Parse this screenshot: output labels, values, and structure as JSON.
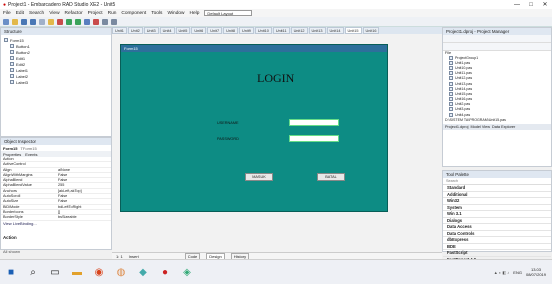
{
  "window": {
    "title": "Project1 - Embarcadero RAD Studio XE2 - Unit5",
    "min": "—",
    "max": "□",
    "close": "✕"
  },
  "menu": [
    "File",
    "Edit",
    "Search",
    "View",
    "Refactor",
    "Project",
    "Run",
    "Component",
    "Tools",
    "Window",
    "Help"
  ],
  "layout_combo": "Default Layout",
  "tabs": [
    "Unit1",
    "Unit2",
    "Unit3",
    "Unit4",
    "Unit5",
    "Unit6",
    "Unit7",
    "Unit8",
    "Unit9",
    "Unit10",
    "Unit11",
    "Unit12",
    "Unit13",
    "Unit14",
    "Unit15",
    "Unit16"
  ],
  "structure": {
    "title": "Structure",
    "items": [
      "Form15",
      "Button1",
      "Button2",
      "Edit1",
      "Edit2",
      "Label1",
      "Label2",
      "Label3"
    ]
  },
  "object_inspector": {
    "title": "Object Inspector",
    "selected": "Form15",
    "selected_type": "TForm15",
    "tabs": [
      "Properties",
      "Events"
    ],
    "rows": [
      [
        "Action",
        ""
      ],
      [
        "ActiveControl",
        ""
      ],
      [
        "Align",
        "alNone"
      ],
      [
        "AlignWithMargins",
        "False"
      ],
      [
        "AlphaBlend",
        "False"
      ],
      [
        "AlphaBlendValue",
        "255"
      ],
      [
        "Anchors",
        "[akLeft,akTop]"
      ],
      [
        "AutoScroll",
        "False"
      ],
      [
        "AutoSize",
        "False"
      ],
      [
        "BiDiMode",
        "bdLeftToRight"
      ],
      [
        "BorderIcons",
        "[]"
      ],
      [
        "BorderStyle",
        "bsSizeable"
      ]
    ],
    "footer": "View LiveBinding...",
    "action_label": "Action",
    "all_shown": "All shown"
  },
  "form": {
    "caption": "Form15",
    "heading": "LOGIN",
    "label_username": "USERNAME",
    "label_password": "PASSWORD",
    "btn_masuk": "MASUK",
    "btn_batal": "BATAL"
  },
  "status": {
    "pos": "1: 1",
    "mode": "Insert",
    "views": [
      "Code",
      "Design",
      "History"
    ]
  },
  "project_manager": {
    "title": "Project1.dproj - Project Manager",
    "file_label": "File",
    "files": [
      "ProjectGroup1",
      "Unit1.pas",
      "Unit10.pas",
      "Unit11.pas",
      "Unit12.pas",
      "Unit13.pas",
      "Unit14.pas",
      "Unit15.pas",
      "Unit16.pas",
      "Unit2.pas",
      "Unit3.pas",
      "Unit4.pas"
    ],
    "path": "D:\\SISTEM TA\\PROGRAM\\Unit15.pas",
    "bottom_tabs": [
      "Project1.dproj",
      "Model View",
      "Data Explorer"
    ]
  },
  "tool_palette": {
    "title": "Tool Palette",
    "search": "Search",
    "categories": [
      "Standard",
      "Additional",
      "Win32",
      "System",
      "Win 3.1",
      "Dialogs",
      "Data Access",
      "Data Controls",
      "dbExpress",
      "BDE",
      "FastScript",
      "FastReport 4.0",
      "Internet",
      "Samples"
    ]
  },
  "taskbar": {
    "lang": "ENG",
    "time": "13.03",
    "date": "08/07/2019"
  }
}
